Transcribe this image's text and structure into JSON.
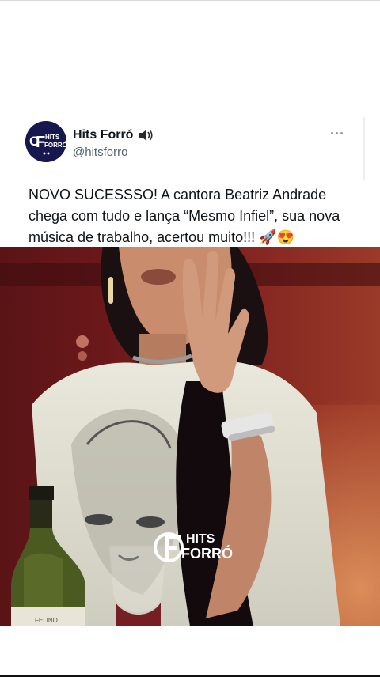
{
  "tweet": {
    "display_name": "Hits Forró",
    "handle": "@hitsforro",
    "text": "NOVO SUCESSSO! A cantora Beatriz Andrade chega com tudo e lança “Mesmo Infiel”, sua nova música de trabalho, acertou muito!!! 🚀😍",
    "more_icon": "ellipsis-icon",
    "speaker_icon": "speaker-icon"
  },
  "avatar": {
    "logo_text_1": "HITS",
    "logo_text_2": "FORRÓ"
  },
  "media": {
    "watermark_line_1": "HITS",
    "watermark_line_2": "FORRÓ",
    "bottle_label": "FELINO"
  },
  "colors": {
    "avatar_bg": "#17174f",
    "text": "#0f1419",
    "handle": "#536471",
    "media_bg": "#3a0c0e"
  }
}
